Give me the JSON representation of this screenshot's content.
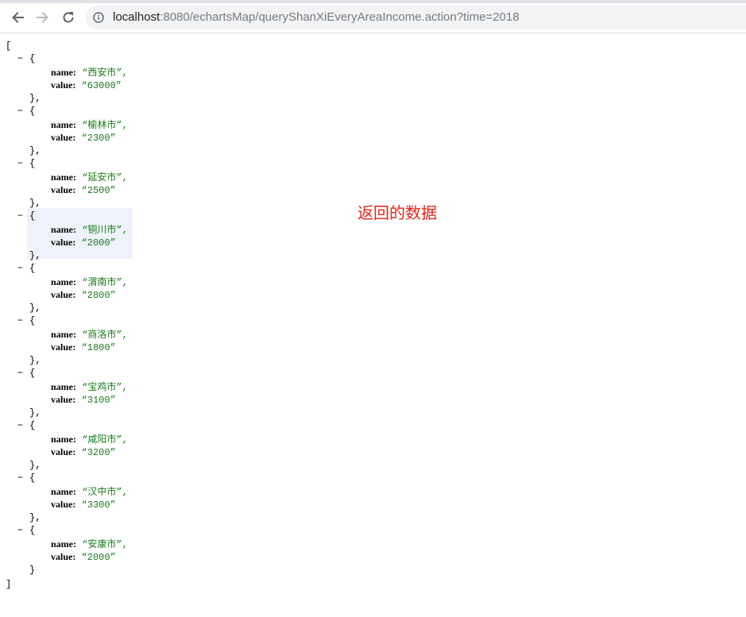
{
  "browser": {
    "url_host": "localhost",
    "url_rest": ":8080/echartsMap/queryShanXiEveryAreaIncome.action?time=2018"
  },
  "json_view": {
    "open_bracket": "[",
    "close_bracket": "]",
    "open_brace": "{",
    "close_brace": "}",
    "close_brace_comma": "},",
    "collapse_symbol": "−",
    "key_name": "name:",
    "key_value": "value:",
    "items": [
      {
        "name": "“西安市”,",
        "value": "“63000”"
      },
      {
        "name": "“榆林市”,",
        "value": "“2300”"
      },
      {
        "name": "“延安市”,",
        "value": "“2500”"
      },
      {
        "name": "“铜川市”,",
        "value": "“2000”"
      },
      {
        "name": "“渭南市”,",
        "value": "“2800”"
      },
      {
        "name": "“商洛市”,",
        "value": "“1800”"
      },
      {
        "name": "“宝鸡市”,",
        "value": "“3100”"
      },
      {
        "name": "“咸阳市”,",
        "value": "“3200”"
      },
      {
        "name": "“汉中市”,",
        "value": "“3300”"
      },
      {
        "name": "“安康市”,",
        "value": "“2000”"
      }
    ],
    "highlighted_index": 3
  },
  "annotation": {
    "text": "返回的数据",
    "color": "#e8231a"
  }
}
